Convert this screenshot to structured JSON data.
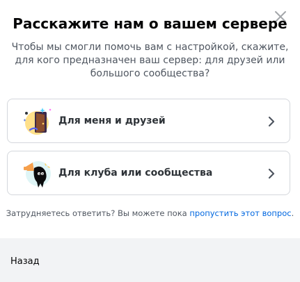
{
  "modal": {
    "title": "Расскажите нам о вашем сервере",
    "subtitle": "Чтобы мы смогли помочь вам с настройкой, скажите, для кого предназначен ваш сервер: для друзей или большого сообщества?"
  },
  "options": [
    {
      "label": "Для меня и друзей",
      "icon": "door-illustration-icon"
    },
    {
      "label": "Для клуба или сообщества",
      "icon": "megaphone-creature-icon"
    }
  ],
  "hint": {
    "prefix": "Затрудняетесь ответить? Вы можете пока ",
    "link": "пропустить этот вопрос",
    "suffix": "."
  },
  "footer": {
    "back_label": "Назад"
  },
  "colors": {
    "link": "#0067e0",
    "border": "#d4d7dc",
    "footer_bg": "#f2f3f5"
  }
}
